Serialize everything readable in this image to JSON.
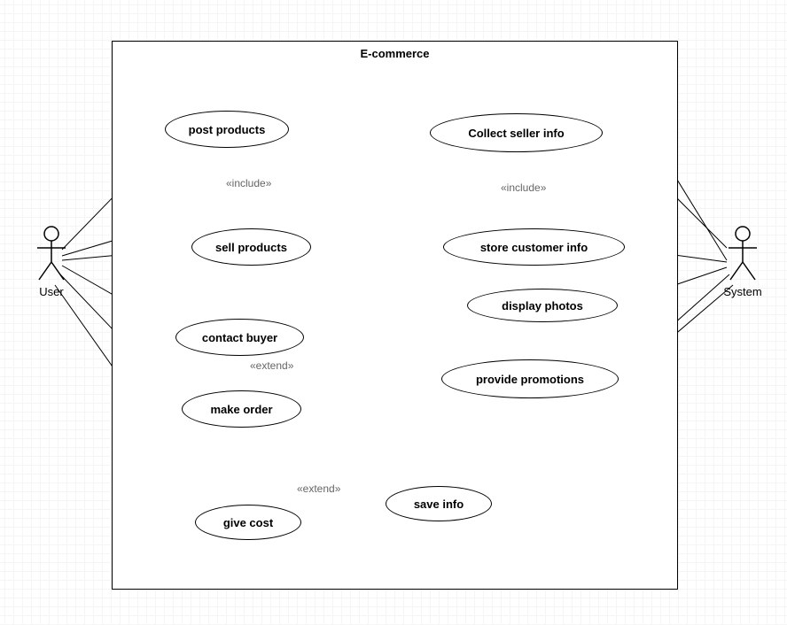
{
  "system": {
    "title": "E-commerce"
  },
  "actors": {
    "user": {
      "label": "User"
    },
    "system": {
      "label": "System"
    }
  },
  "usecases": {
    "post_products": "post products",
    "sell_products": "sell products",
    "collect_seller_info": "Collect seller info",
    "store_customer_info": "store customer info",
    "display_photos": "display photos",
    "contact_buyer": "contact buyer",
    "make_order": "make order",
    "provide_promotions": "provide promotions",
    "give_cost": "give cost",
    "save_info": "save info"
  },
  "relations": {
    "include1": "«include»",
    "include2": "«include»",
    "extend1": "«extend»",
    "extend2": "«extend»"
  },
  "chart_data": {
    "type": "uml-use-case",
    "system": "E-commerce",
    "actors": [
      "User",
      "System"
    ],
    "usecases": [
      "post products",
      "sell products",
      "Collect seller info",
      "store customer info",
      "display photos",
      "contact buyer",
      "make order",
      "provide promotions",
      "give cost",
      "save info"
    ],
    "associations": [
      [
        "User",
        "post products"
      ],
      [
        "User",
        "sell products"
      ],
      [
        "User",
        "Collect seller info"
      ],
      [
        "User",
        "contact buyer"
      ],
      [
        "User",
        "make order"
      ],
      [
        "User",
        "give cost"
      ],
      [
        "System",
        "Collect seller info"
      ],
      [
        "System",
        "store customer info"
      ],
      [
        "System",
        "display photos"
      ],
      [
        "System",
        "provide promotions"
      ],
      [
        "System",
        "save info"
      ]
    ],
    "includes": [
      [
        "post products",
        "sell products"
      ],
      [
        "Collect seller info",
        "store customer info"
      ]
    ],
    "extends": [
      [
        "contact buyer",
        "make order"
      ],
      [
        "give cost",
        "save info"
      ]
    ]
  }
}
